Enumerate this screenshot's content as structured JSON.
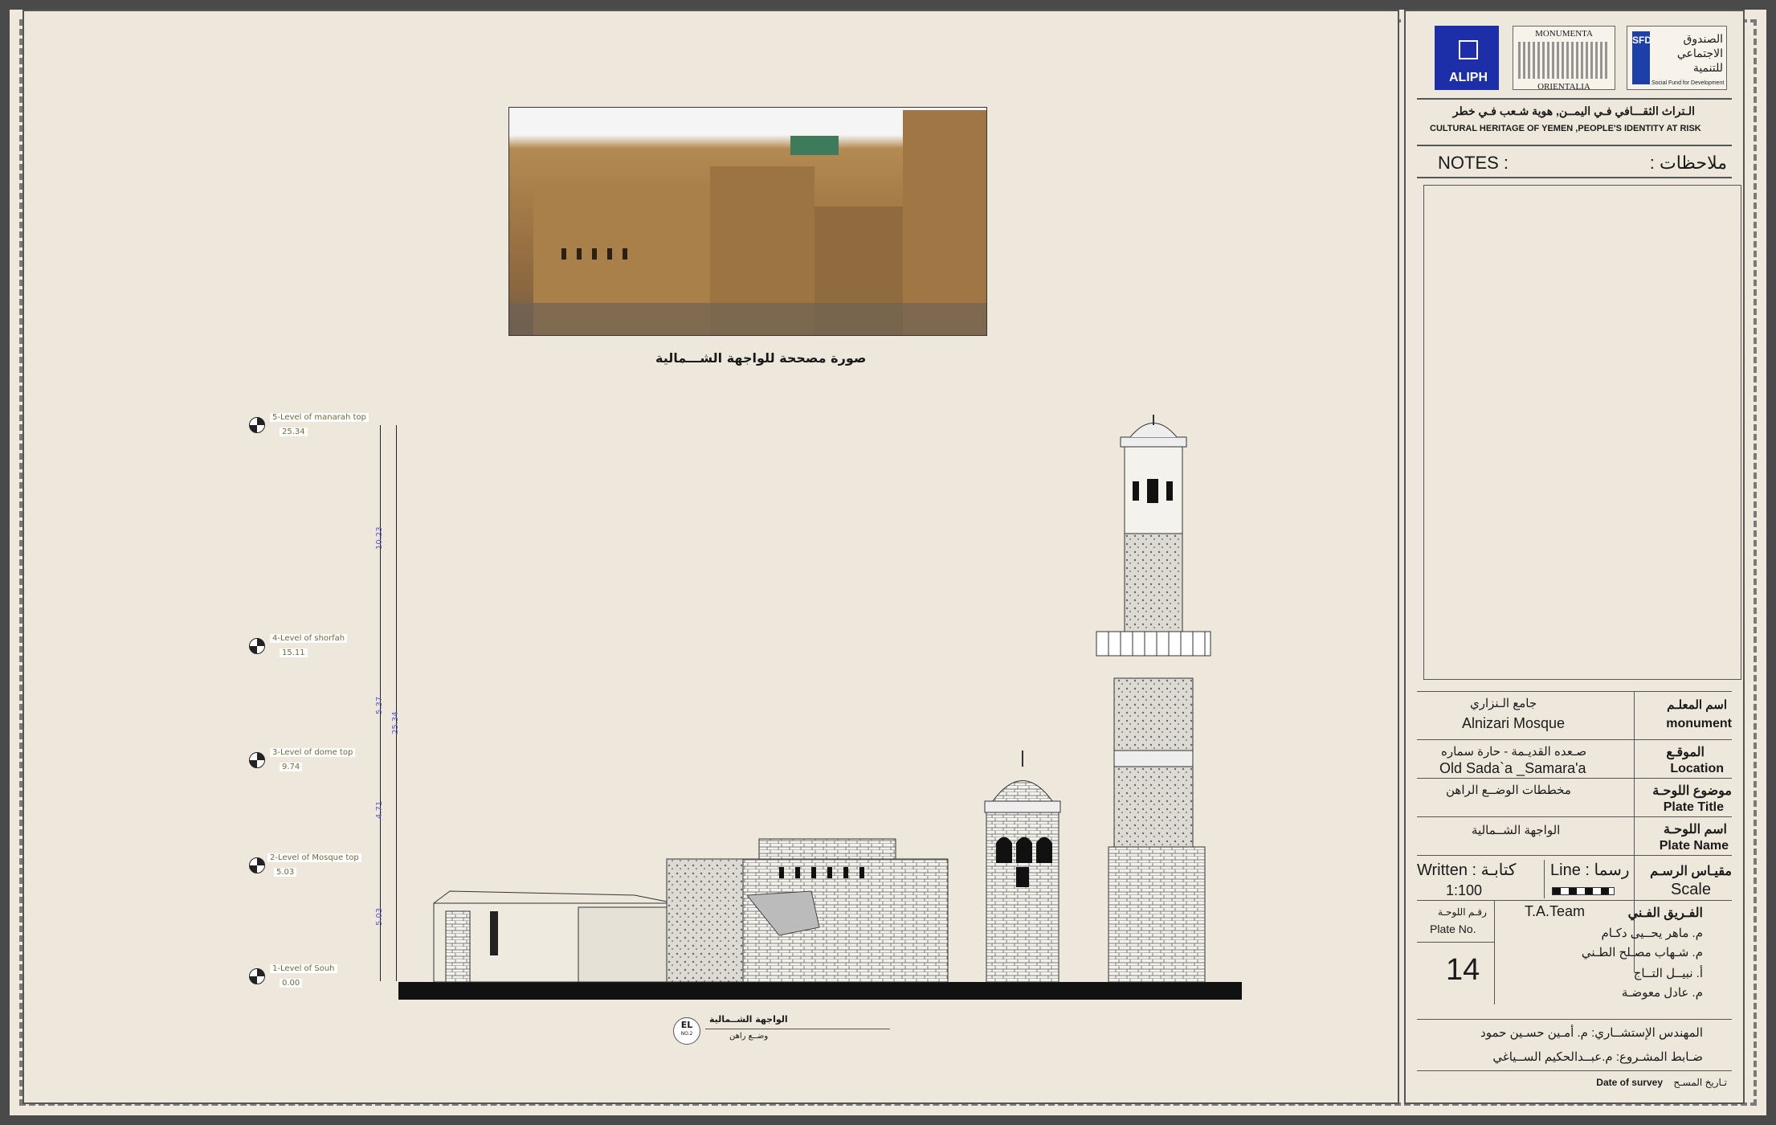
{
  "photo_caption": "صورة مصححة للواجهة الشـــمالية",
  "levels": [
    {
      "label": "5-Level of manarah top",
      "value": "25.34"
    },
    {
      "label": "4-Level of shorfah",
      "value": "15.11"
    },
    {
      "label": "3-Level of dome top",
      "value": "9.74"
    },
    {
      "label": "2-Level of Mosque top",
      "value": "5.03"
    },
    {
      "label": "1-Level of Souh",
      "value": "0.00"
    }
  ],
  "dimensions": [
    "10.23",
    "5.37",
    "4.71",
    "5.03",
    "25.34"
  ],
  "elevation_tag": {
    "code": "EL",
    "number": "NO.2",
    "title": "الواجهة الشــمالية",
    "subtitle": "وضــع راهن"
  },
  "panel": {
    "logos": {
      "aliph": "ALIPH",
      "monumenta_top": "MONUMENTA",
      "monumenta_bottom": "ORIENTALIA",
      "sfd_letters": "SFD",
      "sfd_arabic": "الصندوق الاجتماعي للتنمية",
      "sfd_english": "Social Fund for Development"
    },
    "heritage_ar": "الـتراث الثقـــافي فـي اليمــن, هوية شـعب فـي خطر",
    "heritage_en": "CULTURAL HERITAGE OF YEMEN ,PEOPLE'S IDENTITY AT RISK",
    "notes_en": "NOTES :",
    "notes_ar": "ملاحظات :",
    "monument_ar_label": "اسم المعلـم",
    "monument_en_label": "monument",
    "monument_ar": "جامع الـنزاري",
    "monument_en": "Alnizari Mosque",
    "location_ar_label": "الموقـع",
    "location_en_label": "Location",
    "location_ar": "صـعده القديـمة - حارة سماره",
    "location_en": "Old Sada`a _Samara'a",
    "plate_title_ar_label": "موضوع اللوحـة",
    "plate_title_en_label": "Plate Title",
    "plate_title_ar": "مخططات الوضــع الراهن",
    "plate_name_ar_label": "اسم اللوحـة",
    "plate_name_en_label": "Plate Name",
    "plate_name_ar": "الواجهة الشــمالية",
    "scale_ar_label": "مقيـاس الرسـم",
    "scale_en_label": "Scale",
    "written_label": "Written : كتابـة",
    "written_value": "1:100",
    "line_label": "Line : رسما",
    "team_ar_label": "الفـريق الفـني",
    "team_en": "T.A.Team",
    "plate_no_ar": "رقـم اللوحـة",
    "plate_no_en": "Plate No.",
    "plate_no": "14",
    "team_members": [
      "م. ماهر يحــيى دكـام",
      "م. شـهاب مصـلح الطـني",
      "أ. نبيــل التــاج",
      "م. عادل معوضـة"
    ],
    "consultant": "المهندس الإستشــاري: م. أمـين حسـين حمود",
    "project_officer": "ضـابط المشـروع: م.عبــدالحكيم الســياغي",
    "survey_date_en": "Date of survey",
    "survey_date_ar": "تـاريخ المسـح"
  }
}
